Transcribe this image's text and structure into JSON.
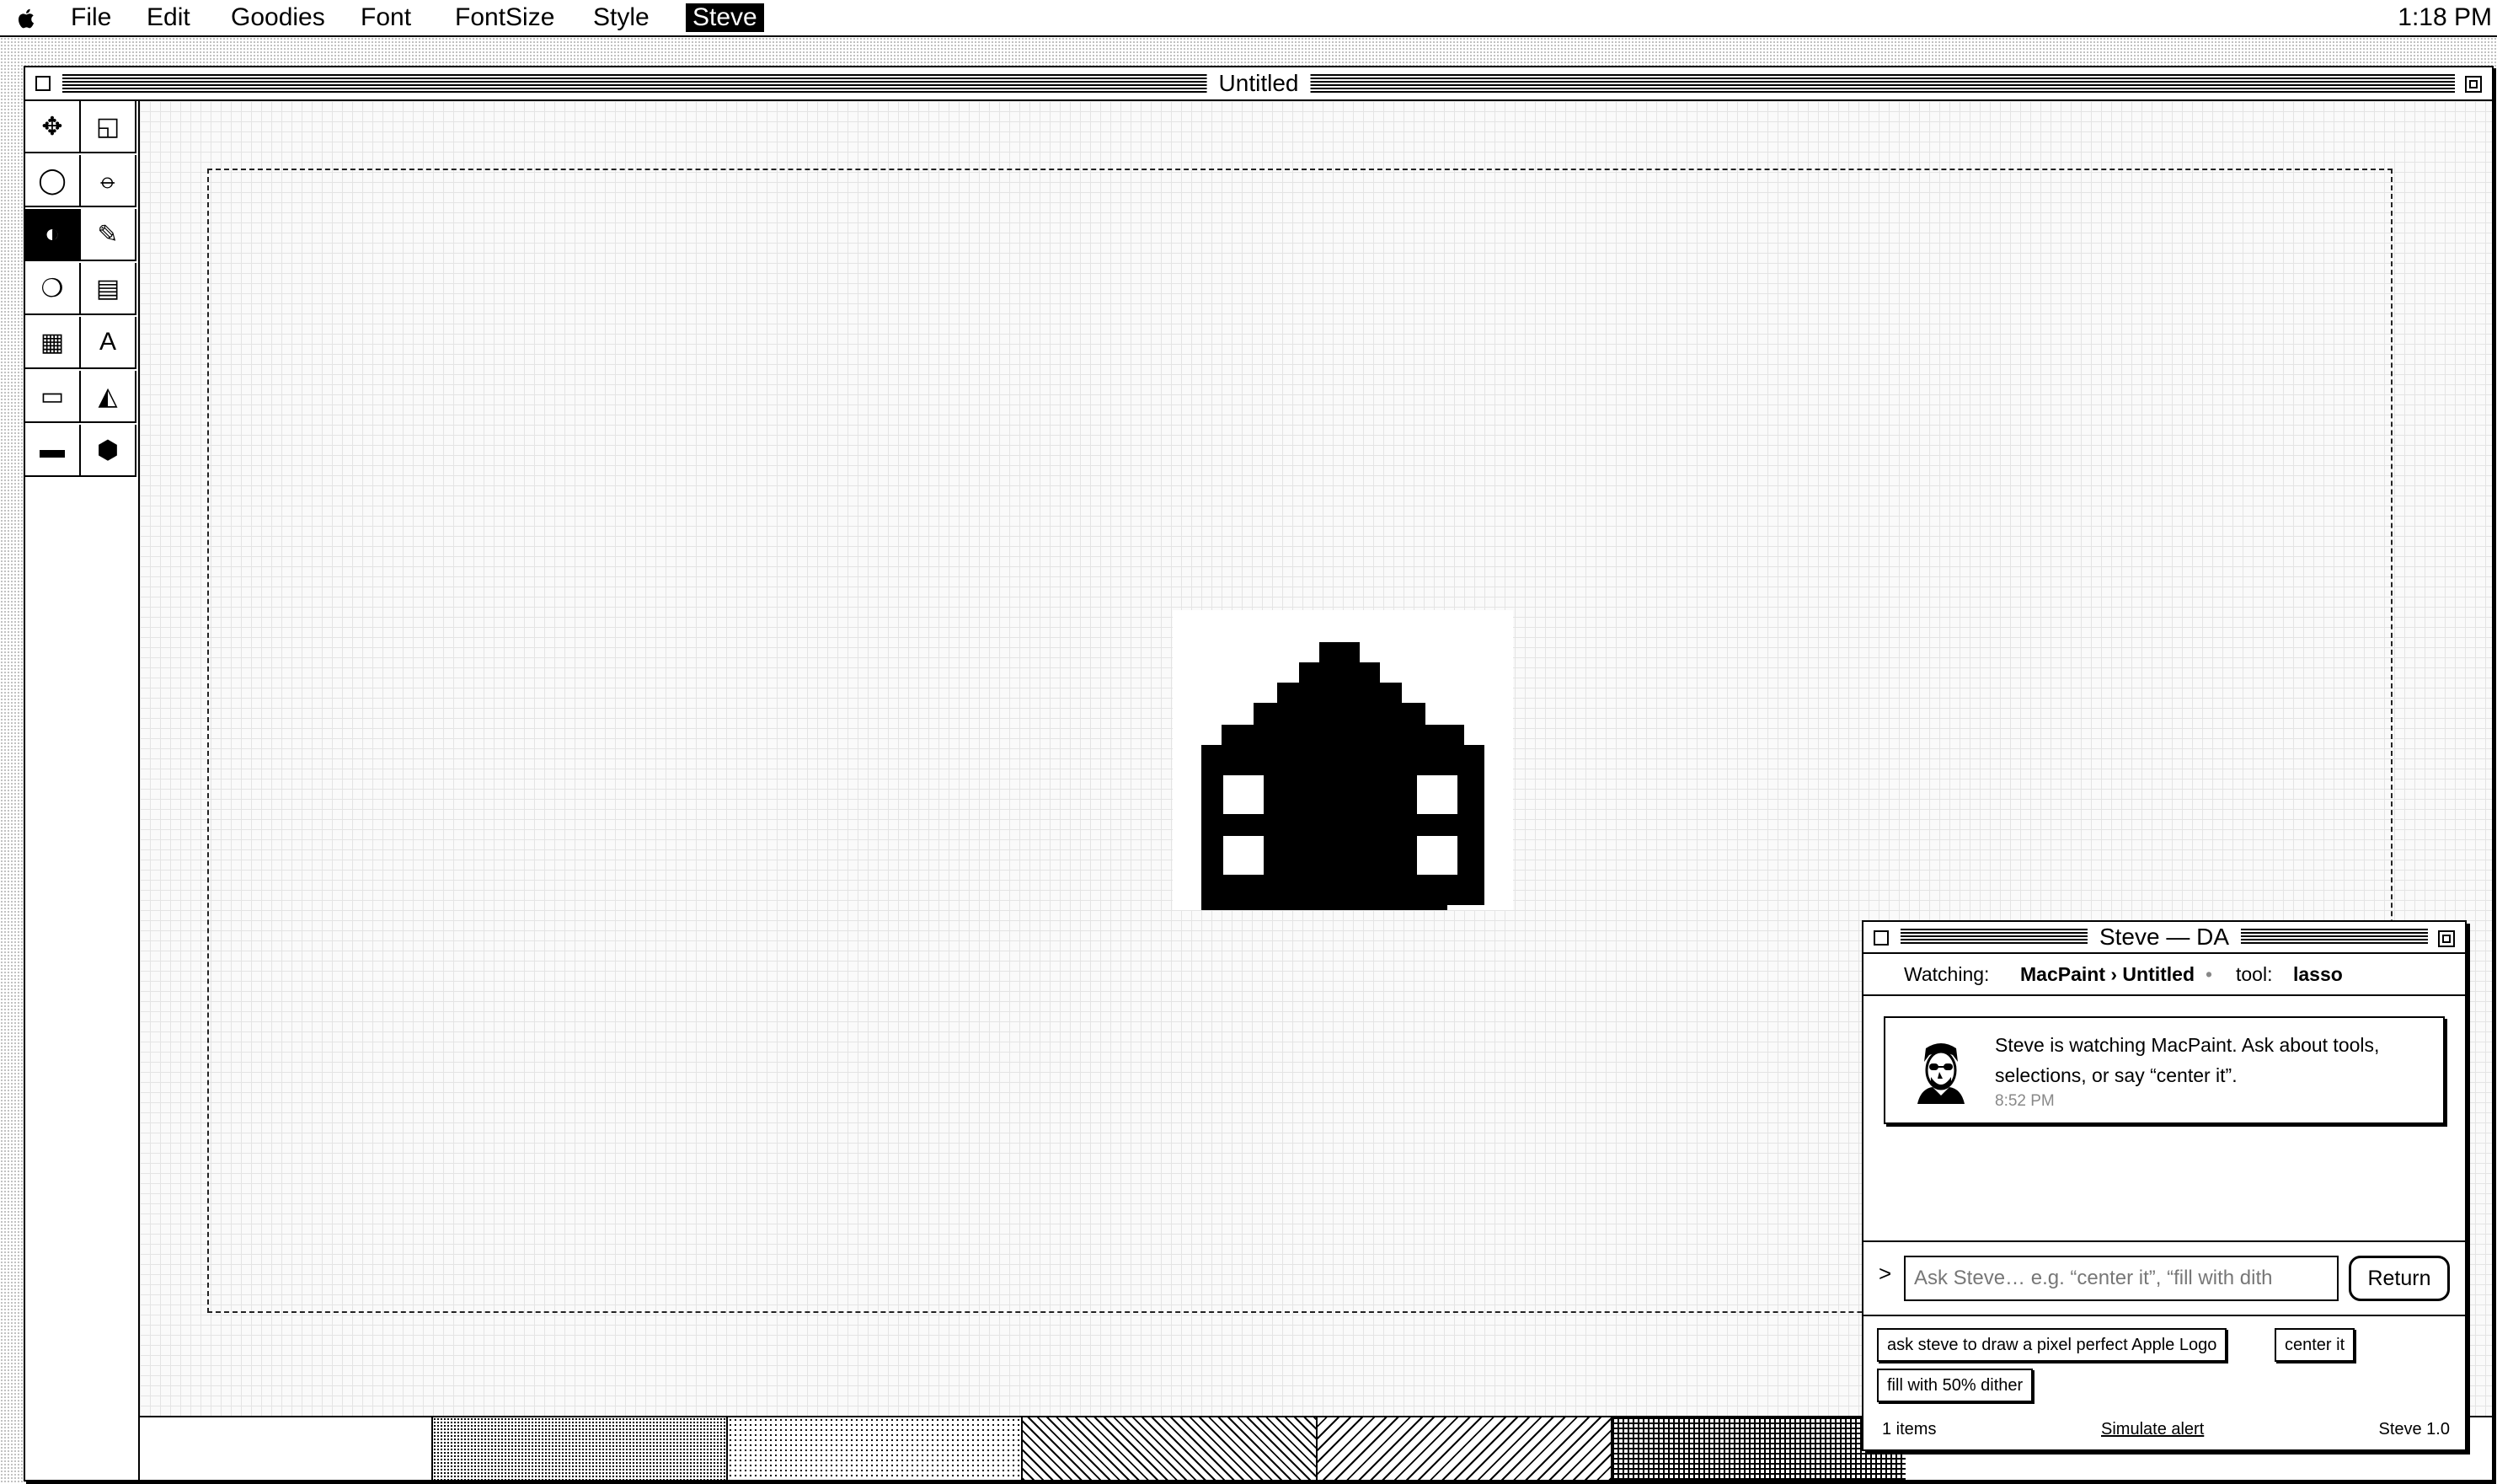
{
  "menubar": {
    "items": [
      "File",
      "Edit",
      "Goodies",
      "Font",
      "FontSize",
      "Style",
      "Steve"
    ],
    "active": "Steve",
    "clock": "1:18 PM"
  },
  "main_window": {
    "title": "Untitled"
  },
  "tools": [
    {
      "name": "selection-move-icon",
      "glyph": "✥"
    },
    {
      "name": "marquee-select-icon",
      "glyph": "◱"
    },
    {
      "name": "lasso-icon",
      "glyph": "◯"
    },
    {
      "name": "eraser-line-icon",
      "glyph": "⦵"
    },
    {
      "name": "fill-dither-icon",
      "glyph": "◐",
      "selected": true
    },
    {
      "name": "pencil-icon",
      "glyph": "✎"
    },
    {
      "name": "arc-icon",
      "glyph": "❍"
    },
    {
      "name": "lines-pattern-icon",
      "glyph": "▤"
    },
    {
      "name": "paint-bucket-icon",
      "glyph": "▦"
    },
    {
      "name": "text-tool-icon",
      "glyph": "A"
    },
    {
      "name": "rectangle-icon",
      "glyph": "▭"
    },
    {
      "name": "spray-icon",
      "glyph": "◭"
    },
    {
      "name": "filled-rect-icon",
      "glyph": "▬"
    },
    {
      "name": "filled-polygon-icon",
      "glyph": "⬢"
    }
  ],
  "steve": {
    "title": "Steve — DA",
    "watching_label": "Watching:",
    "watching_value": "MacPaint › Untitled",
    "bullet": "•",
    "tool_label": "tool:",
    "tool_value": "lasso",
    "message_text": "Steve is watching MacPaint. Ask about tools, selections, or say “center it”.",
    "message_time": "8:52 PM",
    "prompt": ">",
    "input_placeholder": "Ask Steve… e.g. “center it”, “fill with dith",
    "return_label": "Return",
    "chips": [
      "ask steve to draw a pixel perfect Apple Logo",
      "center it",
      "fill with 50% dither"
    ],
    "items_count": "1 items",
    "simulate_label": "Simulate alert",
    "version": "Steve 1.0"
  }
}
